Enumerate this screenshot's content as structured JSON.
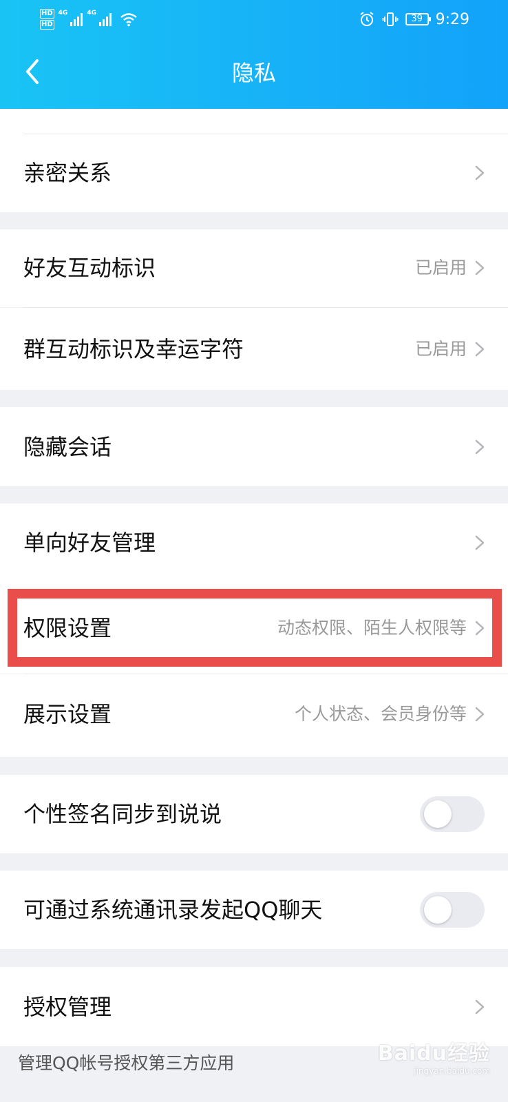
{
  "status_bar": {
    "hd1": "HD",
    "hd2": "HD",
    "net1": "4G",
    "net2": "4G",
    "battery": "39",
    "time": "9:29"
  },
  "header": {
    "title": "隐私"
  },
  "rows": [
    {
      "label": "亲密关系",
      "value": ""
    },
    {
      "label": "好友互动标识",
      "value": "已启用"
    },
    {
      "label": "群互动标识及幸运字符",
      "value": "已启用"
    },
    {
      "label": "隐藏会话",
      "value": ""
    },
    {
      "label": "单向好友管理",
      "value": ""
    },
    {
      "label": "权限设置",
      "value": "动态权限、陌生人权限等"
    },
    {
      "label": "展示设置",
      "value": "个人状态、会员身份等"
    },
    {
      "label": "个性签名同步到说说",
      "toggle": false
    },
    {
      "label": "可通过系统通讯录发起QQ聊天",
      "toggle": false
    },
    {
      "label": "授权管理",
      "value": ""
    }
  ],
  "footnote": "管理QQ帐号授权第三方应用",
  "watermark": {
    "main": "Baidu经验",
    "sub": "jingyan.baidu.com"
  },
  "colors": {
    "header_start": "#19c4f5",
    "header_end": "#12a2fa",
    "highlight": "#ea4e4b"
  }
}
